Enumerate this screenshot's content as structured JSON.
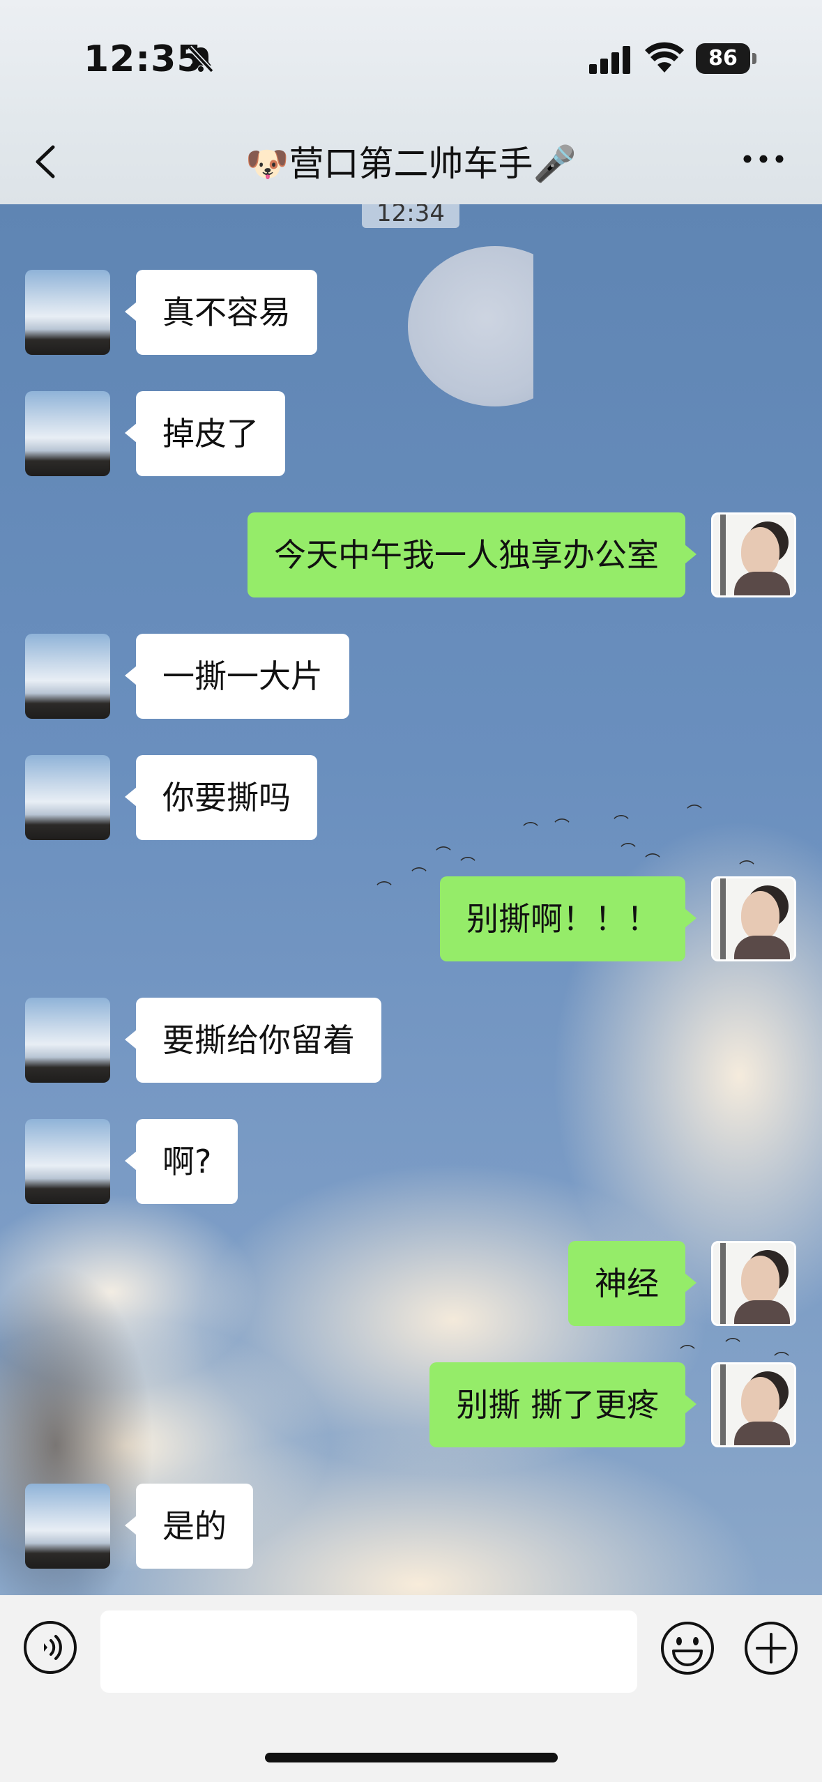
{
  "status_bar": {
    "time": "12:35",
    "battery": "86",
    "icons": [
      "bell-muted-icon",
      "signal-icon",
      "wifi-icon",
      "battery-icon"
    ]
  },
  "header": {
    "title": "🐶营口第二帅车手🎤",
    "back_icon": "chevron-left-icon",
    "more_icon": "more-dots-icon"
  },
  "chat": {
    "timestamp": "12:34",
    "messages": [
      {
        "side": "left",
        "text": "真不容易"
      },
      {
        "side": "left",
        "text": "掉皮了"
      },
      {
        "side": "right",
        "text": "今天中午我一人独享办公室"
      },
      {
        "side": "left",
        "text": "一撕一大片"
      },
      {
        "side": "left",
        "text": "你要撕吗"
      },
      {
        "side": "right",
        "text": "别撕啊！！！"
      },
      {
        "side": "left",
        "text": "要撕给你留着"
      },
      {
        "side": "left",
        "text": "啊?"
      },
      {
        "side": "right",
        "text": "神经"
      },
      {
        "side": "right",
        "text": "别撕 撕了更疼"
      },
      {
        "side": "left",
        "text": "是的"
      }
    ]
  },
  "input_bar": {
    "text_value": "",
    "voice_icon": "voice-icon",
    "emoji_icon": "emoji-icon",
    "plus_icon": "plus-icon"
  },
  "colors": {
    "bubble_self": "#95ec69",
    "bubble_other": "#ffffff"
  }
}
